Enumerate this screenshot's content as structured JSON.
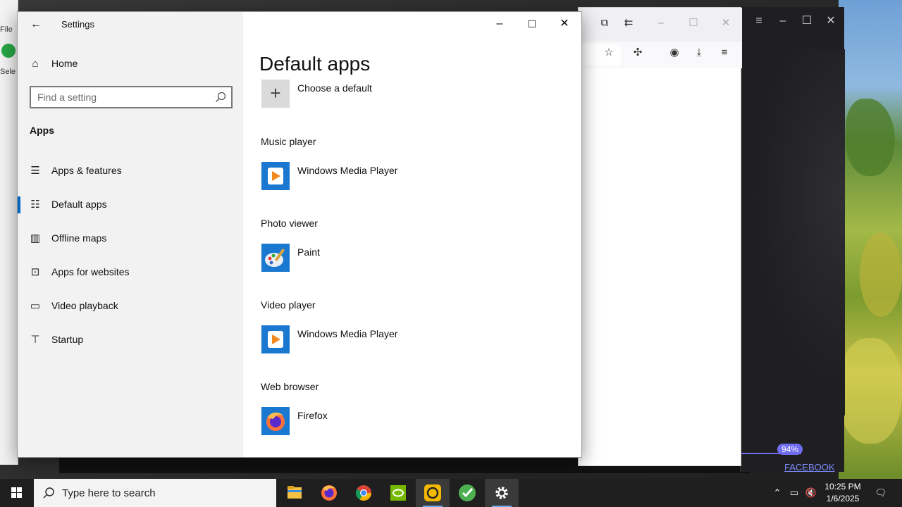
{
  "settings_window": {
    "title": "Settings",
    "home_label": "Home",
    "search_placeholder": "Find a setting",
    "section_label": "Apps",
    "nav_items": [
      {
        "label": "Apps & features",
        "icon": "list-icon"
      },
      {
        "label": "Default apps",
        "icon": "default-apps-icon",
        "active": true
      },
      {
        "label": "Offline maps",
        "icon": "map-icon"
      },
      {
        "label": "Apps for websites",
        "icon": "web-apps-icon"
      },
      {
        "label": "Video playback",
        "icon": "video-icon"
      },
      {
        "label": "Startup",
        "icon": "startup-icon"
      }
    ],
    "page_title": "Default apps",
    "choose_default_label": "Choose a default",
    "categories": [
      {
        "label": "Music player",
        "app": "Windows Media Player",
        "icon": "windows-media-player-icon"
      },
      {
        "label": "Photo viewer",
        "app": "Paint",
        "icon": "paint-icon"
      },
      {
        "label": "Video player",
        "app": "Windows Media Player",
        "icon": "windows-media-player-icon"
      },
      {
        "label": "Web browser",
        "app": "Firefox",
        "icon": "firefox-icon"
      }
    ]
  },
  "background": {
    "left_app_labels": [
      "File",
      "Sele"
    ],
    "dark_app_progress": "94%",
    "dark_app_link": "FACEBOOK"
  },
  "taskbar": {
    "search_placeholder": "Type here to search",
    "pinned_apps": [
      "file-explorer",
      "firefox",
      "chrome",
      "nvidia",
      "app-yellow",
      "app-green",
      "settings"
    ],
    "time": "10:25 PM",
    "date": "1/6/2025"
  },
  "colors": {
    "accent": "#0067c0",
    "sidebar_bg": "#f2f2f2",
    "taskbar_bg": "#1f1f1f",
    "progress": "#6f6cf0"
  }
}
